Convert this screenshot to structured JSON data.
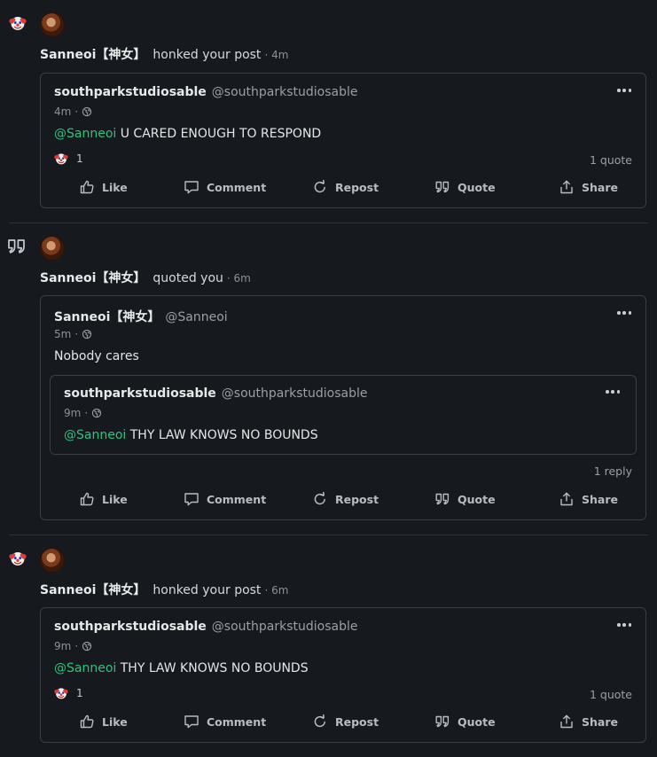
{
  "notifications": [
    {
      "type": "honk",
      "actor": "Sanneoi【神女】",
      "action": "honked your post",
      "ago": "· 4m",
      "post": {
        "author": "southparkstudiosable",
        "handle": "@southparkstudiosable",
        "time": "4m",
        "mention": "@Sanneoi",
        "text": "U CARED ENOUGH TO RESPOND",
        "reaction_count": "1",
        "right_count": "1 quote"
      }
    },
    {
      "type": "quote",
      "actor": "Sanneoi【神女】",
      "action": "quoted you",
      "ago": "· 6m",
      "post": {
        "author": "Sanneoi【神女】",
        "handle": "@Sanneoi",
        "time": "5m",
        "text": "Nobody cares",
        "right_count": "1 reply",
        "quoted": {
          "author": "southparkstudiosable",
          "handle": "@southparkstudiosable",
          "time": "9m",
          "mention": "@Sanneoi",
          "text": "THY LAW KNOWS NO BOUNDS"
        }
      }
    },
    {
      "type": "honk",
      "actor": "Sanneoi【神女】",
      "action": "honked your post",
      "ago": "· 6m",
      "post": {
        "author": "southparkstudiosable",
        "handle": "@southparkstudiosable",
        "time": "9m",
        "mention": "@Sanneoi",
        "text": "THY LAW KNOWS NO BOUNDS",
        "reaction_count": "1",
        "right_count": "1 quote"
      }
    }
  ],
  "actions": {
    "like": "Like",
    "comment": "Comment",
    "repost": "Repost",
    "quote": "Quote",
    "share": "Share"
  },
  "meta_separator": "·",
  "icons": {
    "honk": "clown-face-icon",
    "quote": "quote-icon",
    "visibility": "globe-icon"
  },
  "colors": {
    "background": "#16191d",
    "mention": "#2ec27e",
    "border": "#3a3f45"
  }
}
